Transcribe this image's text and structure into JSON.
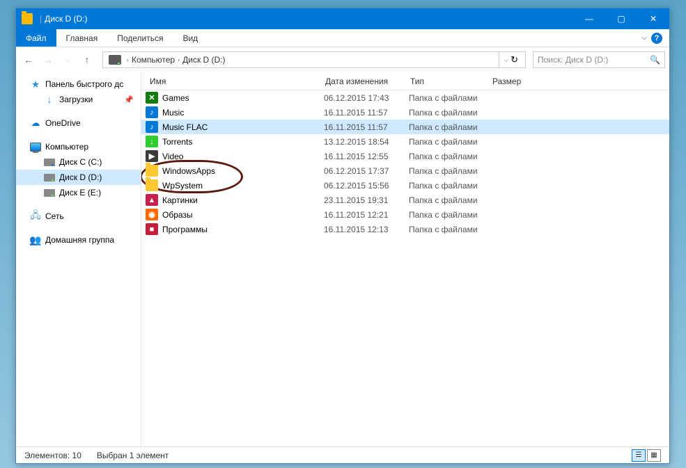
{
  "title": "Диск D (D:)",
  "ribbon": {
    "file": "Файл",
    "main": "Главная",
    "share": "Поделиться",
    "view": "Вид"
  },
  "breadcrumb": {
    "a": "Компьютер",
    "b": "Диск D (D:)"
  },
  "search_placeholder": "Поиск: Диск D (D:)",
  "sidebar": {
    "quick": "Панель быстрого дс",
    "downloads": "Загрузки",
    "onedrive": "OneDrive",
    "computer": "Компьютер",
    "c": "Диск C (C:)",
    "d": "Диск D (D:)",
    "e": "Диск E (E:)",
    "net": "Сеть",
    "home": "Домашняя группа"
  },
  "columns": {
    "name": "Имя",
    "date": "Дата изменения",
    "type": "Тип",
    "size": "Размер"
  },
  "type_folder": "Папка с файлами",
  "rows": [
    {
      "icon": "xbox",
      "glyph": "✕",
      "name": "Games",
      "date": "06.12.2015 17:43"
    },
    {
      "icon": "note",
      "glyph": "♪",
      "name": "Music",
      "date": "16.11.2015 11:57"
    },
    {
      "icon": "note",
      "glyph": "♪",
      "name": "Music FLAC",
      "date": "16.11.2015 11:57",
      "sel": true
    },
    {
      "icon": "tor",
      "glyph": "↓",
      "name": "Torrents",
      "date": "13.12.2015 18:54"
    },
    {
      "icon": "vid",
      "glyph": "▶",
      "name": "Video",
      "date": "16.11.2015 12:55"
    },
    {
      "icon": "folder",
      "glyph": "",
      "name": "WindowsApps",
      "date": "06.12.2015 17:37"
    },
    {
      "icon": "folder",
      "glyph": "",
      "name": "WpSystem",
      "date": "06.12.2015 15:56"
    },
    {
      "icon": "img",
      "glyph": "▲",
      "name": "Картинки",
      "date": "23.11.2015 19:31"
    },
    {
      "icon": "disc",
      "glyph": "◉",
      "name": "Образы",
      "date": "16.11.2015 12:21"
    },
    {
      "icon": "prog",
      "glyph": "■",
      "name": "Программы",
      "date": "16.11.2015 12:13"
    }
  ],
  "status": {
    "count": "Элементов: 10",
    "sel": "Выбран 1 элемент"
  }
}
